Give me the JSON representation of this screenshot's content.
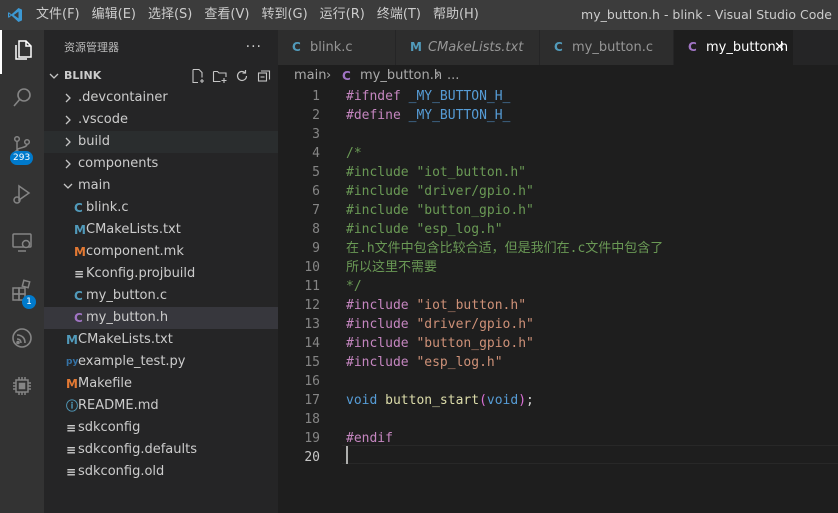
{
  "title_bar": {
    "menu": [
      "文件(F)",
      "编辑(E)",
      "选择(S)",
      "查看(V)",
      "转到(G)",
      "运行(R)",
      "终端(T)",
      "帮助(H)"
    ],
    "window_title": "my_button.h - blink - Visual Studio Code"
  },
  "activity_bar": {
    "items": [
      {
        "icon": "files-icon"
      },
      {
        "icon": "search-icon"
      },
      {
        "icon": "source-control-icon",
        "badge": "293"
      },
      {
        "icon": "run-debug-icon"
      },
      {
        "icon": "remote-explorer-icon"
      },
      {
        "icon": "extensions-icon",
        "badge": "1"
      },
      {
        "icon": "esp-idf-icon"
      },
      {
        "icon": "chip-icon"
      }
    ]
  },
  "sidebar": {
    "title": "资源管理器",
    "more": "···",
    "section": "BLINK",
    "items": [
      {
        "label": ".devcontainer",
        "type": "folder",
        "expanded": false,
        "depth": 0
      },
      {
        "label": ".vscode",
        "type": "folder",
        "expanded": false,
        "depth": 0
      },
      {
        "label": "build",
        "type": "folder",
        "expanded": false,
        "depth": 0
      },
      {
        "label": "components",
        "type": "folder",
        "expanded": false,
        "depth": 0
      },
      {
        "label": "main",
        "type": "folder",
        "expanded": true,
        "depth": 0
      },
      {
        "label": "blink.c",
        "type": "c",
        "icon_text": "C",
        "depth": 1
      },
      {
        "label": "CMakeLists.txt",
        "type": "cmake",
        "icon_text": "M",
        "depth": 1
      },
      {
        "label": "component.mk",
        "type": "makefile",
        "icon_text": "M",
        "depth": 1
      },
      {
        "label": "Kconfig.projbuild",
        "type": "text",
        "icon_text": "≡",
        "depth": 1
      },
      {
        "label": "my_button.c",
        "type": "c",
        "icon_text": "C",
        "depth": 1
      },
      {
        "label": "my_button.h",
        "type": "h",
        "icon_text": "C",
        "depth": 1
      },
      {
        "label": "CMakeLists.txt",
        "type": "cmake",
        "icon_text": "M",
        "depth": 0
      },
      {
        "label": "example_test.py",
        "type": "python",
        "icon_text": "py",
        "depth": 0
      },
      {
        "label": "Makefile",
        "type": "makefile",
        "icon_text": "M",
        "depth": 0
      },
      {
        "label": "README.md",
        "type": "info",
        "icon_text": "ⓘ",
        "depth": 0
      },
      {
        "label": "sdkconfig",
        "type": "text",
        "icon_text": "≡",
        "depth": 0
      },
      {
        "label": "sdkconfig.defaults",
        "type": "text",
        "icon_text": "≡",
        "depth": 0
      },
      {
        "label": "sdkconfig.old",
        "type": "text",
        "icon_text": "≡",
        "depth": 0
      }
    ]
  },
  "tabs": [
    {
      "label": "blink.c",
      "icon_text": "C",
      "type": "c",
      "active": false
    },
    {
      "label": "CMakeLists.txt",
      "icon_text": "M",
      "type": "cmake",
      "active": false
    },
    {
      "label": "my_button.c",
      "icon_text": "C",
      "type": "c",
      "active": false
    },
    {
      "label": "my_button.h",
      "icon_text": "C",
      "type": "h",
      "active": true,
      "close": "✕"
    }
  ],
  "breadcrumb": {
    "folder": "main",
    "sep": "›",
    "icon_text": "C",
    "file": "my_button.h",
    "rest": "..."
  },
  "editor": {
    "current_line": 20,
    "lines": [
      [
        [
          "#ifndef ",
          "#c586c0"
        ],
        [
          "_MY_BUTTON_H_",
          "#569cd6"
        ]
      ],
      [
        [
          "#define ",
          "#c586c0"
        ],
        [
          "_MY_BUTTON_H_",
          "#569cd6"
        ]
      ],
      [],
      [
        [
          "/*",
          "#6a9955"
        ]
      ],
      [
        [
          "#include \"iot_button.h\"",
          "#6a9955"
        ]
      ],
      [
        [
          "#include \"driver/gpio.h\"",
          "#6a9955"
        ]
      ],
      [
        [
          "#include \"button_gpio.h\"",
          "#6a9955"
        ]
      ],
      [
        [
          "#include \"esp_log.h\"",
          "#6a9955"
        ]
      ],
      [
        [
          "在.h文件中包含比较合适，但是我们在.c文件中包含了",
          "#6a9955"
        ]
      ],
      [
        [
          "所以这里不需要",
          "#6a9955"
        ]
      ],
      [
        [
          "*/",
          "#6a9955"
        ]
      ],
      [
        [
          "#include ",
          "#c586c0"
        ],
        [
          "\"iot_button.h\"",
          "#ce9178"
        ]
      ],
      [
        [
          "#include ",
          "#c586c0"
        ],
        [
          "\"driver/gpio.h\"",
          "#ce9178"
        ]
      ],
      [
        [
          "#include ",
          "#c586c0"
        ],
        [
          "\"button_gpio.h\"",
          "#ce9178"
        ]
      ],
      [
        [
          "#include ",
          "#c586c0"
        ],
        [
          "\"esp_log.h\"",
          "#ce9178"
        ]
      ],
      [],
      [
        [
          "void ",
          "#569cd6"
        ],
        [
          "button_start",
          "#dcdcaa"
        ],
        [
          "(",
          "#da70d6"
        ],
        [
          "void",
          "#569cd6"
        ],
        [
          ")",
          "#da70d6"
        ],
        [
          ";",
          "#d4d4d4"
        ]
      ],
      [],
      [
        [
          "#endif",
          "#c586c0"
        ]
      ],
      []
    ]
  },
  "colors": {
    "c": "#519aba",
    "h": "#a074c4",
    "cmake": "#519aba",
    "makefile": "#e37933",
    "python": "#3572a5",
    "info": "#519aba",
    "text": "#cccccc",
    "accent": "#007acc"
  }
}
